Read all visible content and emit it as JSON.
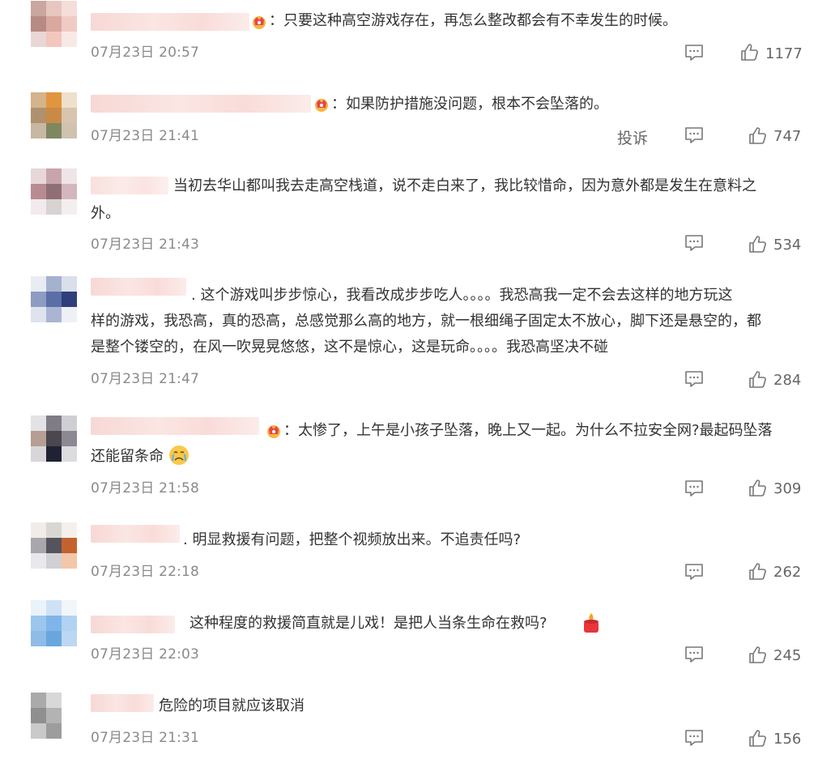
{
  "comments": [
    {
      "text": "：只要这种高空游戏存在，再怎么整改都会有不幸发生的时候。",
      "time": "07月23日 20:57",
      "likes": "1177"
    },
    {
      "text": "：如果防护措施没问题，根本不会坠落的。",
      "time": "07月23日 21:41",
      "likes": "747",
      "report": "投诉"
    },
    {
      "text": "当初去华山都叫我去走高空栈道，说不走白来了，我比较惜命，因为意外都是发生在意料之",
      "text2": "外。",
      "time": "07月23日 21:43",
      "likes": "534"
    },
    {
      "text": ". 这个游戏叫步步惊心，我看改成步步吃人。。。。我恐高我一定不会去这样的地方玩这",
      "text2": "样的游戏，我恐高，真的恐高，总感觉那么高的地方，就一根细绳子固定太不放心，脚下还是悬空的，都",
      "text3": "是整个镂空的，在风一吹晃晃悠悠，这不是惊心，这是玩命。。。。我恐高坚决不碰",
      "time": "07月23日 21:47",
      "likes": "284"
    },
    {
      "text": "：太惨了，上午是小孩子坠落，晚上又一起。为什么不拉安全网?最起码坠落",
      "text2": "还能留条命",
      "time": "07月23日 21:58",
      "likes": "309"
    },
    {
      "text": ". 明显救援有问题，把整个视频放出来。不追责任吗?",
      "time": "07月23日 22:18",
      "likes": "262"
    },
    {
      "text": "这种程度的救援简直就是儿戏！是把人当条生命在救吗?",
      "time": "07月23日 22:03",
      "likes": "245"
    },
    {
      "text": "危险的项目就应该取消",
      "time": "07月23日 21:31",
      "likes": "156"
    }
  ],
  "icons": {
    "reply": "comment-bubble-icon",
    "like": "thumbs-up-icon",
    "badge": "crown-badge-icon",
    "emoji_cry": "crying-face-emoji",
    "emoji_candle": "candle-emoji"
  },
  "colors": {
    "text": "#333333",
    "meta": "#8a8a8a",
    "action": "#666666",
    "badge": "#e8434f"
  }
}
